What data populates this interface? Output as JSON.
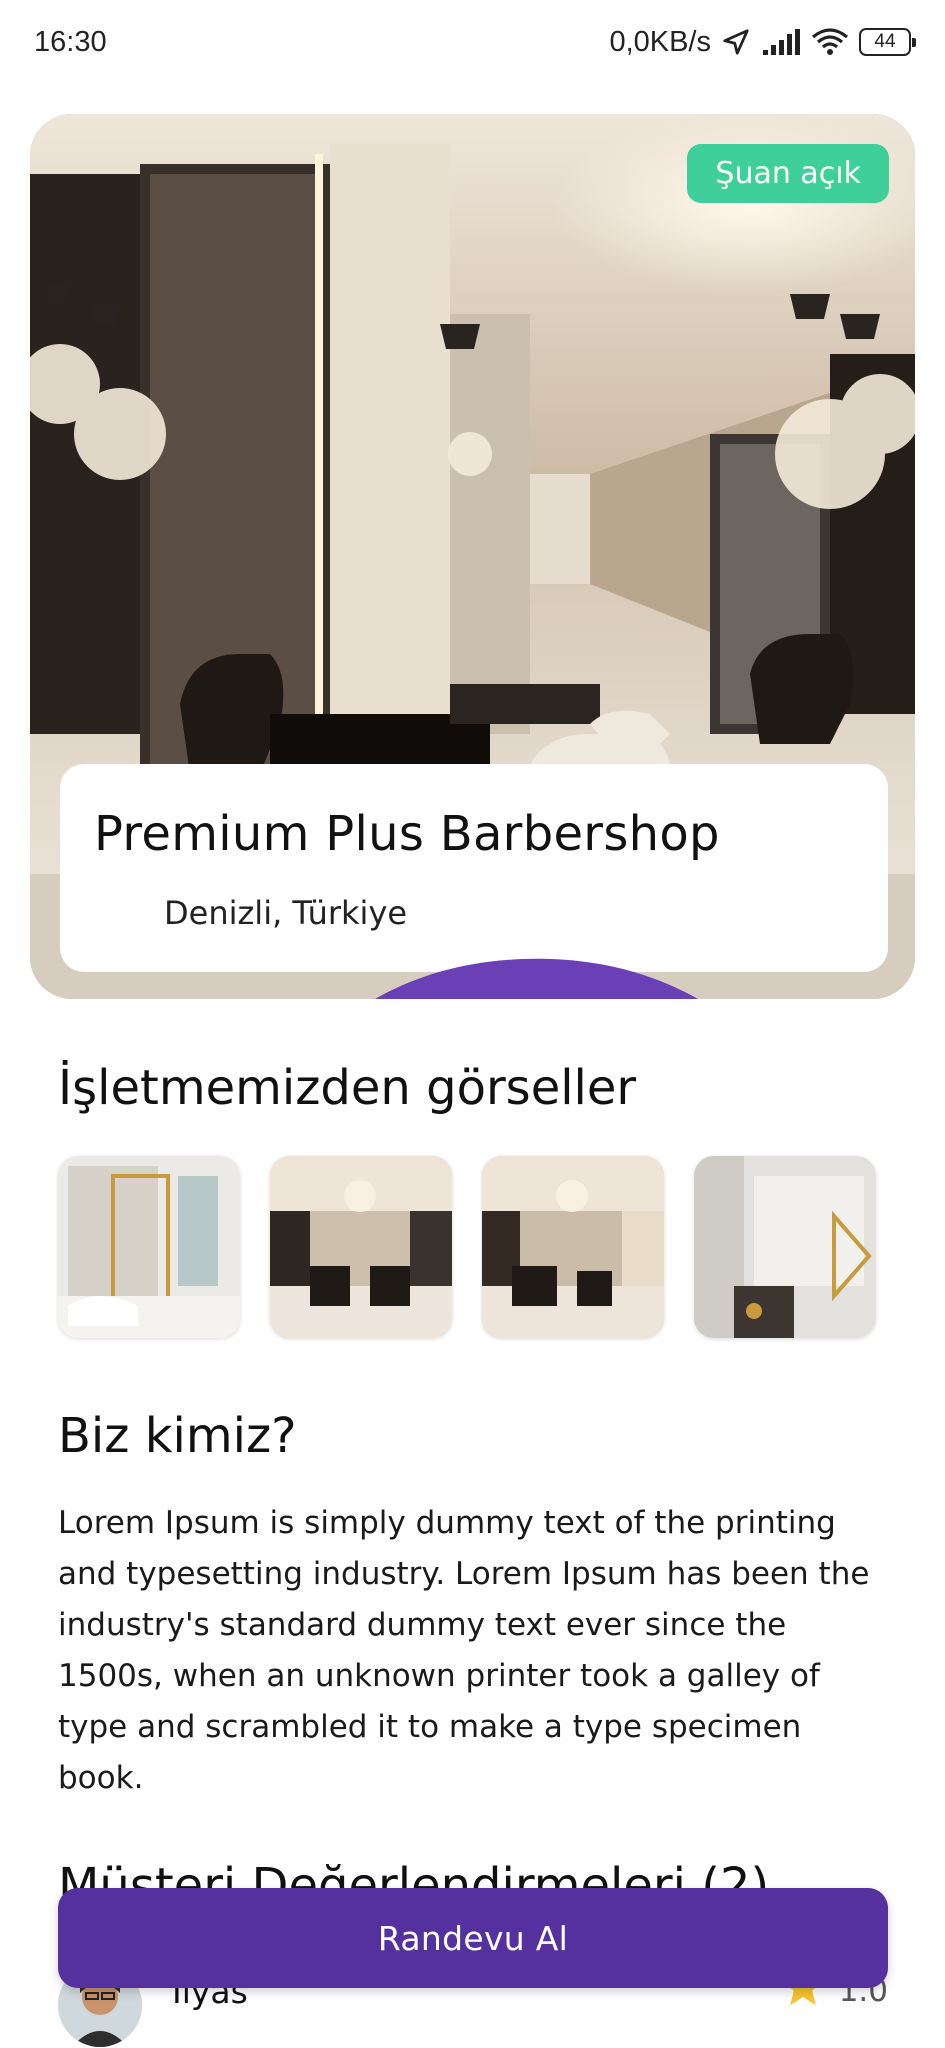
{
  "status_bar": {
    "time": "16:30",
    "network_speed": "0,0KB/s",
    "battery": "44",
    "icons": [
      "location-arrow-icon",
      "signal-icon",
      "wifi-icon",
      "battery-icon"
    ]
  },
  "hero": {
    "status_badge": "Şuan açık",
    "shop_name": "Premium Plus Barbershop",
    "location": "Denizli, Türkiye",
    "location_icon": "location-pin-icon"
  },
  "gallery": {
    "title": "İşletmemizden görseller"
  },
  "about": {
    "title": "Biz kimiz?",
    "text": "Lorem Ipsum is simply dummy text of the printing and typesetting industry. Lorem Ipsum has been the industry's standard dummy text ever since the 1500s, when an unknown printer took a galley of type and scrambled it to make a type specimen book."
  },
  "reviews": {
    "title": "Müşteri Değerlendirmeleri (2)",
    "items": [
      {
        "name": "Ilyas",
        "rating": "1.0",
        "icon": "star-icon"
      }
    ]
  },
  "cta": {
    "label": "Randevu Al"
  },
  "colors": {
    "primary": "#55309f",
    "badge_green": "#3ecf9a",
    "pin_purple": "#6b3fb5",
    "star_yellow": "#f7c430"
  }
}
